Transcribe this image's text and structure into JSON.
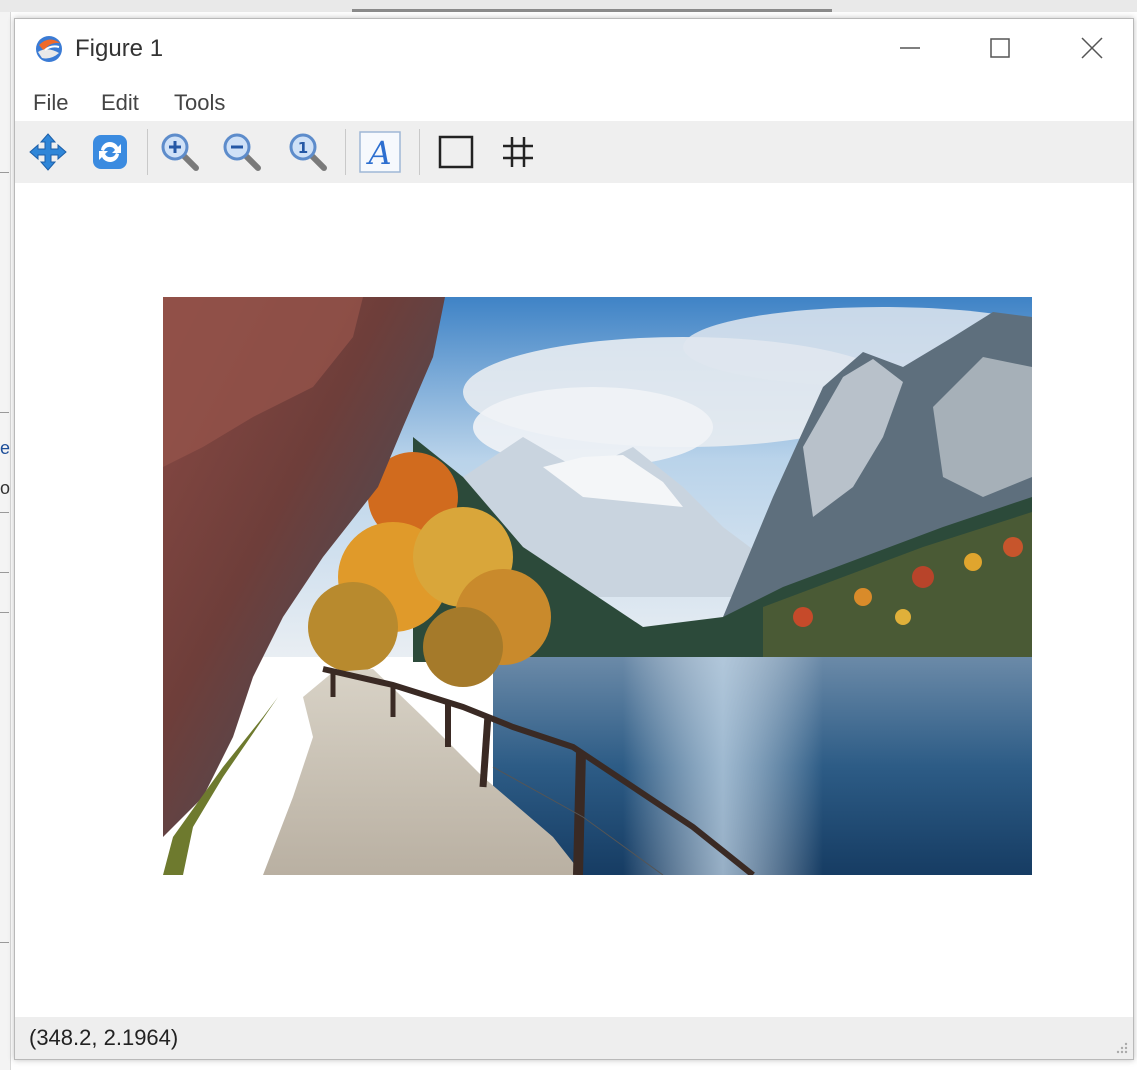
{
  "window": {
    "title": "Figure 1",
    "controls": {
      "minimize_glyph": "—",
      "maximize_glyph": "☐",
      "close_glyph": "✕"
    }
  },
  "menu": {
    "items": [
      {
        "label": "File"
      },
      {
        "label": "Edit"
      },
      {
        "label": "Tools"
      }
    ]
  },
  "toolbar": {
    "buttons": [
      {
        "name": "pan-icon"
      },
      {
        "name": "refresh-icon"
      },
      {
        "name": "zoom-in-icon"
      },
      {
        "name": "zoom-out-icon"
      },
      {
        "name": "zoom-reset-icon"
      },
      {
        "name": "text-label-icon",
        "glyph": "A"
      },
      {
        "name": "rectangle-icon"
      },
      {
        "name": "grid-icon",
        "glyph": "#"
      }
    ]
  },
  "statusbar": {
    "coordinates": "(348.2, 2.1964)"
  },
  "colors": {
    "toolbar_bg": "#efefef",
    "status_bg": "#eeeeee",
    "accent_blue": "#2d6fd0"
  }
}
